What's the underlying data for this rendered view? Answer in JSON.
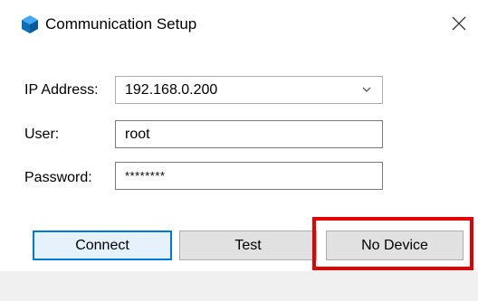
{
  "window": {
    "title": "Communication Setup"
  },
  "icons": {
    "app": "app-cube-icon",
    "close": "close-icon",
    "dropdown": "chevron-down-icon"
  },
  "form": {
    "ip": {
      "label": "IP Address:",
      "value": "192.168.0.200"
    },
    "user": {
      "label": "User:",
      "value": "root"
    },
    "password": {
      "label": "Password:",
      "value": "********"
    }
  },
  "buttons": {
    "connect": "Connect",
    "test": "Test",
    "no_device": "No Device"
  },
  "colors": {
    "accent": "#0078d7",
    "highlight": "#e60000",
    "footer_bg": "#f0f0f0"
  }
}
